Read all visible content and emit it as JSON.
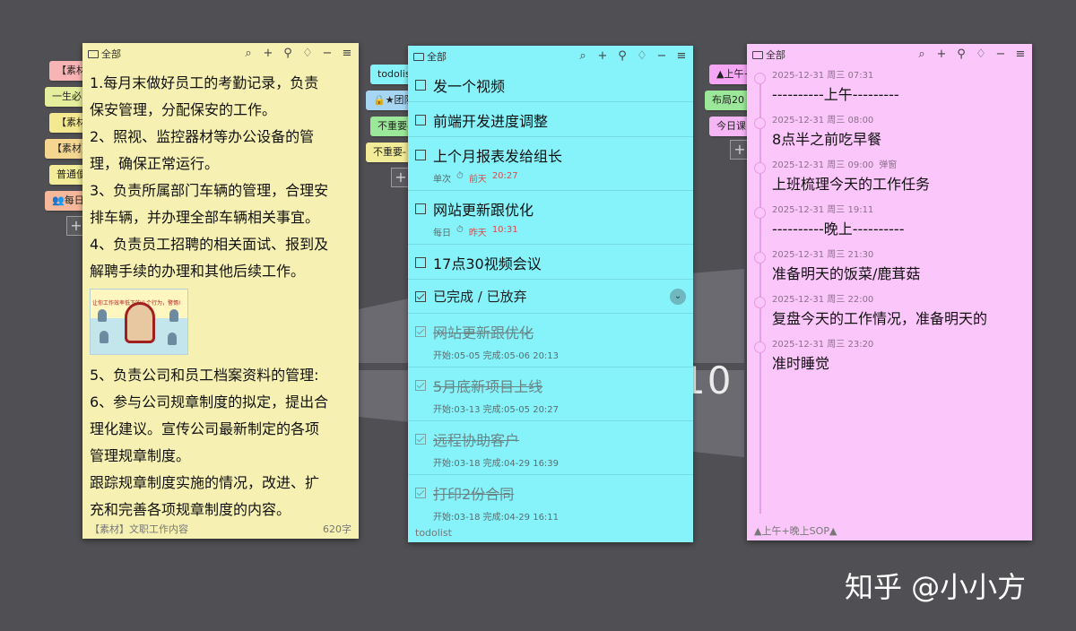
{
  "watermark": "知乎 @小小方",
  "desktop_text": "10",
  "left_tabs": [
    {
      "label": "【素材】",
      "color": "#f8b4b4"
    },
    {
      "label": "一生必",
      "color": "#e4ee9c"
    },
    {
      "label": "【素材】",
      "color": "#f4e890"
    },
    {
      "label": "【素材】",
      "color": "#f4d690"
    },
    {
      "label": "普通便",
      "color": "#f2ec98"
    },
    {
      "label": "👥每日",
      "color": "#f6b89a"
    }
  ],
  "mid_tabs": [
    {
      "label": "todolist",
      "color": "#86f3fa"
    },
    {
      "label": "🔒★团队",
      "color": "#a6d6f4"
    },
    {
      "label": "不重要-",
      "color": "#9ce89a"
    },
    {
      "label": "不重要-",
      "color": "#f2ec98"
    }
  ],
  "right_tabs": [
    {
      "label": "▲上午+晚",
      "color": "#f6a6f4"
    },
    {
      "label": "布局20",
      "color": "#9ce89a"
    },
    {
      "label": "今日课",
      "color": "#f6b6f6"
    }
  ],
  "add_symbol": "+",
  "yellow_note": {
    "folder": "全部",
    "tools": [
      "⌕",
      "+",
      "⚲",
      "♢",
      "−",
      "≡"
    ],
    "lines_top": [
      "1.每月末做好员工的考勤记录，负责",
      "保安管理，分配保安的工作。",
      "2、照视、监控器材等办公设备的管",
      "理，确保正常运行。",
      "3、负责所属部门车辆的管理，合理安",
      "排车辆，并办理全部车辆相关事宜。",
      "4、负责员工招聘的相关面试、报到及",
      "解聘手续的办理和其他后续工作。"
    ],
    "image_caption": "让你工作效率低下的八个行为，警惕!",
    "lines_bottom": [
      "5、负责公司和员工档案资料的管理:",
      "6、参与公司规章制度的拟定，提出合",
      "理化建议。宣传公司最新制定的各项",
      "管理规章制度。",
      "跟踪规章制度实施的情况，改进、扩",
      "充和完善各项规章制度的内容。"
    ],
    "footer_left": "【素材】文职工作内容",
    "footer_right": "620字"
  },
  "cyan_note": {
    "folder": "全部",
    "tools": [
      "⌕",
      "+",
      "⚲",
      "♢",
      "−",
      "≡"
    ],
    "todos": [
      {
        "text": "发一个视频",
        "meta": []
      },
      {
        "text": "前端开发进度调整",
        "meta": []
      },
      {
        "text": "上个月报表发给组长",
        "meta": [
          "单次",
          "⏱",
          "前天",
          "20:27"
        ]
      },
      {
        "text": "网站更新跟优化",
        "meta": [
          "每日",
          "⏱",
          "昨天",
          "10:31"
        ]
      },
      {
        "text": "17点30视频会议",
        "meta": []
      }
    ],
    "section_label": "已完成 / 已放弃",
    "section_icon": "⌄",
    "done": [
      {
        "text": "网站更新跟优化",
        "meta": "开始:05-05  完成:05-06 20:13"
      },
      {
        "text": "5月底新项目上线",
        "meta": "开始:03-13  完成:05-05 20:27"
      },
      {
        "text": "远程协助客户",
        "meta": "开始:03-18  完成:04-29 16:39"
      },
      {
        "text": "打印2份合同",
        "meta": "开始:03-18  完成:04-29 16:11"
      }
    ],
    "footer": "todolist"
  },
  "pink_note": {
    "folder": "全部",
    "tools": [
      "⌕",
      "+",
      "⚲",
      "♢",
      "−",
      "≡"
    ],
    "entries": [
      {
        "time": "2025-12-31 周三 07:31",
        "tag": "",
        "text": "----------上午---------"
      },
      {
        "time": "2025-12-31 周三 08:00",
        "tag": "",
        "text": "8点半之前吃早餐"
      },
      {
        "time": "2025-12-31 周三 09:00",
        "tag": "弹窗",
        "text": "上班梳理今天的工作任务"
      },
      {
        "time": "2025-12-31 周三 19:11",
        "tag": "",
        "text": "----------晚上----------"
      },
      {
        "time": "2025-12-31 周三 21:30",
        "tag": "",
        "text": "准备明天的饭菜/鹿茸菇"
      },
      {
        "time": "2025-12-31 周三 22:00",
        "tag": "",
        "text": "复盘今天的工作情况，准备明天的"
      },
      {
        "time": "2025-12-31 周三 23:20",
        "tag": "",
        "text": "准时睡觉"
      }
    ],
    "footer": "▲上午+晚上SOP▲"
  }
}
